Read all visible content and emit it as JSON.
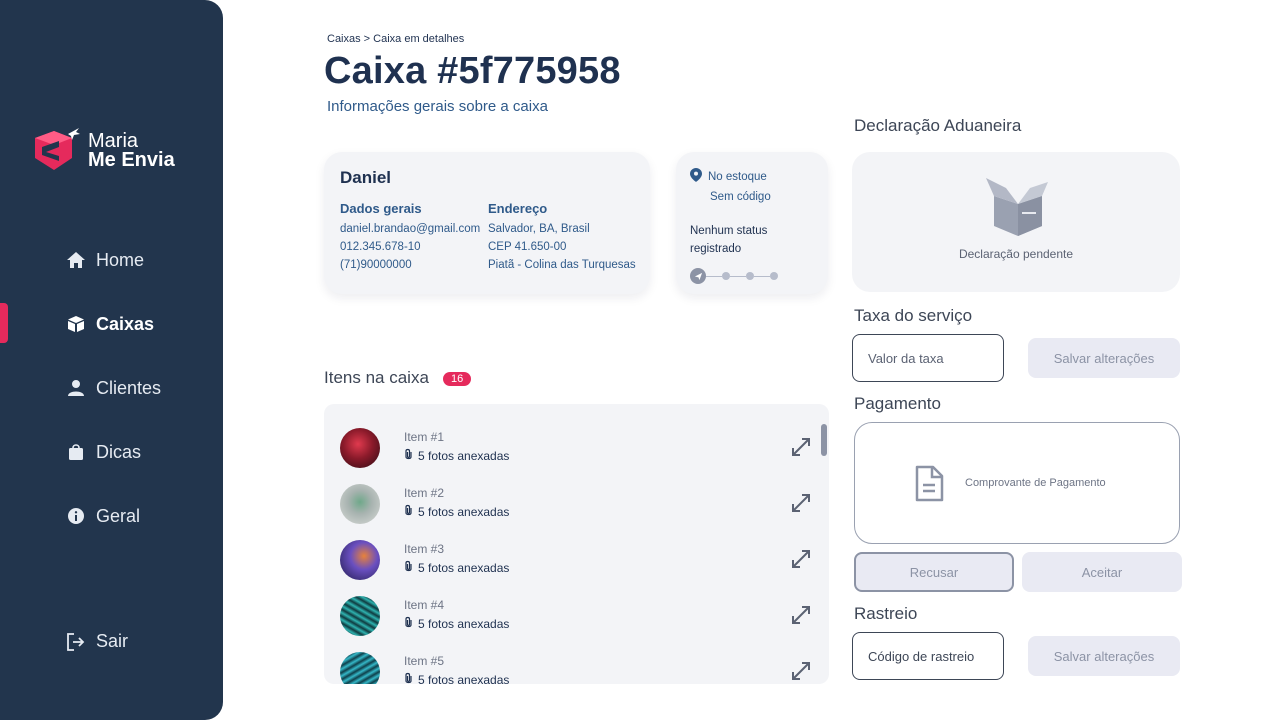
{
  "brand": {
    "line1": "Maria",
    "line2": "Me Envia",
    "color": "#e52a5c"
  },
  "sidebar": {
    "items": [
      {
        "label": "Home",
        "icon": "home-icon"
      },
      {
        "label": "Caixas",
        "icon": "box-icon",
        "active": true
      },
      {
        "label": "Clientes",
        "icon": "user-icon"
      },
      {
        "label": "Dicas",
        "icon": "bag-icon"
      },
      {
        "label": "Geral",
        "icon": "info-icon"
      }
    ],
    "logout": "Sair"
  },
  "header": {
    "breadcrumb": "Caixas > Caixa em detalhes",
    "title": "Caixa #5f775958",
    "subtitle": "Informações gerais sobre a caixa"
  },
  "client": {
    "name": "Daniel",
    "general_head": "Dados gerais",
    "email": "daniel.brandao@gmail.com",
    "document": "012.345.678-10",
    "phone": "(71)90000000",
    "address_head": "Endereço",
    "city": "Salvador, BA, Brasil",
    "zip": "CEP 41.650-00",
    "district": "Piatã - Colina das Turquesas"
  },
  "status": {
    "location": "No estoque",
    "code": "Sem código",
    "none": "Nenhum status registrado"
  },
  "items": {
    "title": "Itens na caixa",
    "count": "16",
    "list": [
      {
        "name": "Item #1",
        "photos": "5 fotos anexadas",
        "color": "#8a1a2a"
      },
      {
        "name": "Item #2",
        "photos": "5 fotos anexadas",
        "color": "#a8b3b0"
      },
      {
        "name": "Item #3",
        "photos": "5 fotos anexadas",
        "color": "#3b2f7a"
      },
      {
        "name": "Item #4",
        "photos": "5 fotos anexadas",
        "color": "#1d6a6a"
      },
      {
        "name": "Item #5",
        "photos": "5 fotos anexadas",
        "color": "#1a7a8a"
      }
    ]
  },
  "customs": {
    "title": "Declaração Aduaneira",
    "pending": "Declaração pendente"
  },
  "fee": {
    "title": "Taxa do serviço",
    "placeholder": "Valor da taxa",
    "save": "Salvar alterações"
  },
  "payment": {
    "title": "Pagamento",
    "receipt": "Comprovante de Pagamento",
    "reject": "Recusar",
    "accept": "Aceitar"
  },
  "tracking": {
    "title": "Rastreio",
    "placeholder": "Código de rastreio",
    "save": "Salvar alterações"
  }
}
